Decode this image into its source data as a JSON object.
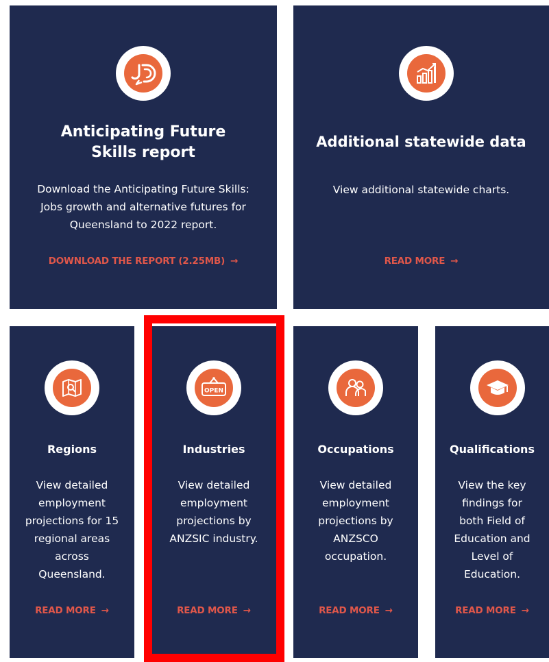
{
  "colors": {
    "card_bg": "#1f2a4f",
    "accent": "#e9683c",
    "link": "#e0574a",
    "highlight": "#ff0000"
  },
  "cards": [
    {
      "title": "Anticipating Future Skills report",
      "desc": "Download the Anticipating Future Skills: Jobs growth and alternative futures for Queensland to 2022 report.",
      "link": "DOWNLOAD THE REPORT (2.25MB)",
      "icon": "jd-logo-icon"
    },
    {
      "title": "Additional statewide data",
      "desc": "View additional statewide charts.",
      "link": "READ MORE",
      "icon": "bar-chart-icon"
    },
    {
      "title": "Regions",
      "desc": "View detailed employment projections for 15 regional areas across Queensland.",
      "link": "READ MORE",
      "icon": "map-icon"
    },
    {
      "title": "Industries",
      "desc": "View detailed employment projections by ANZSIC industry.",
      "link": "READ MORE",
      "icon": "open-sign-icon",
      "sign_text": "OPEN"
    },
    {
      "title": "Occupations",
      "desc": "View detailed employment projections by ANZSCO occupation.",
      "link": "READ MORE",
      "icon": "people-icon"
    },
    {
      "title": "Qualifications",
      "desc": "View the key findings for both Field of Education and Level of Education.",
      "link": "READ MORE",
      "icon": "graduation-cap-icon"
    }
  ],
  "arrow": "→"
}
